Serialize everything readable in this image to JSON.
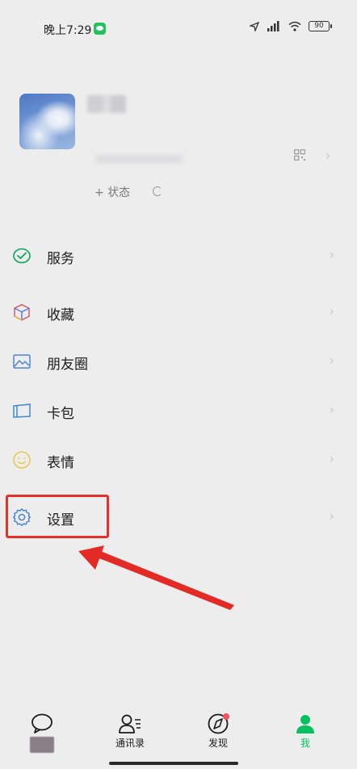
{
  "status_bar": {
    "time": "晚上7:29",
    "battery": "90"
  },
  "profile": {
    "status_label": "+ 状态"
  },
  "menu": [
    {
      "label": "服务",
      "icon": "wechat-pay-icon"
    },
    {
      "label": "收藏",
      "icon": "favorites-cube-icon"
    },
    {
      "label": "朋友圈",
      "icon": "moments-photo-icon"
    },
    {
      "label": "卡包",
      "icon": "card-wallet-icon"
    },
    {
      "label": "表情",
      "icon": "sticker-smile-icon"
    },
    {
      "label": "设置",
      "icon": "settings-gear-icon"
    }
  ],
  "tabs": [
    {
      "label": "",
      "icon": "chat-bubble-icon"
    },
    {
      "label": "通讯录",
      "icon": "contacts-icon"
    },
    {
      "label": "发现",
      "icon": "discover-compass-icon"
    },
    {
      "label": "我",
      "icon": "me-person-icon",
      "active": true
    }
  ],
  "colors": {
    "background": "#ededed",
    "wechat_green": "#07c160",
    "highlight_red": "#e7302a",
    "badge_red": "#f2545b"
  }
}
